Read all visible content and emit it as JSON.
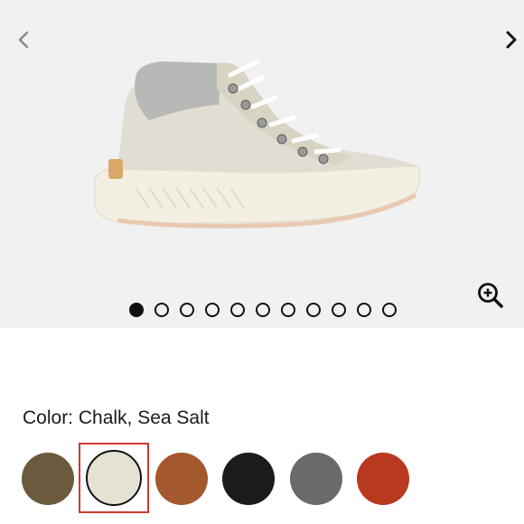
{
  "gallery": {
    "background": "#f1f1f1",
    "prev_icon": "chevron-left-icon",
    "next_icon": "chevron-right-icon",
    "zoom_icon": "zoom-in-icon",
    "image_count": 11,
    "active_index": 0,
    "product_image": "chalk high-top hiker sneaker with grey felt collar, white laces and silver hooks"
  },
  "product": {
    "color_label": "Color: Chalk, Sea Salt",
    "selected_swatch": 1,
    "swatches": [
      {
        "name": "olive-brown",
        "color": "#6b5a3e"
      },
      {
        "name": "chalk",
        "color": "#e6e1d5"
      },
      {
        "name": "rust-brown",
        "color": "#a4582e"
      },
      {
        "name": "black",
        "color": "#1b1b1b"
      },
      {
        "name": "grey",
        "color": "#6c6a68"
      },
      {
        "name": "red",
        "color": "#b8391f"
      }
    ]
  }
}
